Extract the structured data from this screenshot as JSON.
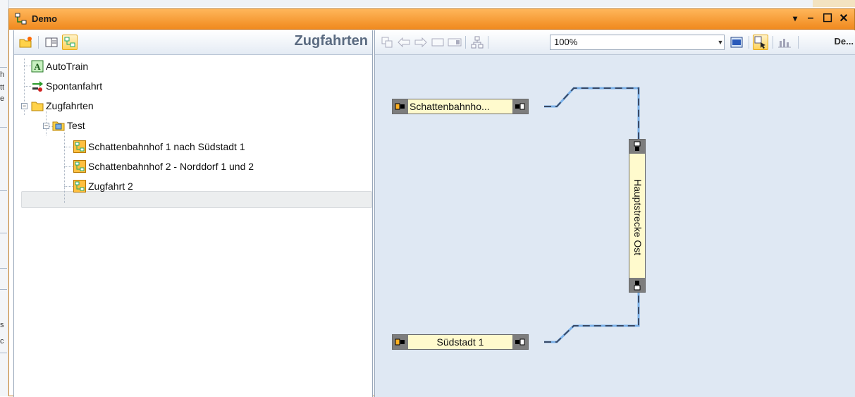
{
  "window": {
    "title": "Demo",
    "controls": [
      "▾",
      "–",
      "☐",
      "✕"
    ]
  },
  "background_fragments": [
    "h",
    "tt",
    "e",
    "s",
    "c"
  ],
  "left_panel": {
    "title": "Zugfahrten",
    "toolbar_icons": [
      "new-folder-icon",
      "list-view-icon",
      "tree-view-icon"
    ]
  },
  "tree": {
    "items": [
      {
        "label": "AutoTrain",
        "icon": "autotrain-icon"
      },
      {
        "label": "Spontanfahrt",
        "icon": "spontaneous-run-icon"
      },
      {
        "label": "Zugfahrten",
        "icon": "folder-icon"
      },
      {
        "label": "Test",
        "icon": "test-folder-icon"
      },
      {
        "label": "Schattenbahnhof 1 nach Südstadt 1",
        "icon": "train-route-icon"
      },
      {
        "label": "Schattenbahnhof 2 - Norddorf 1 und 2",
        "icon": "train-route-icon"
      },
      {
        "label": "Zugfahrt 2",
        "icon": "train-route-icon",
        "selected": true
      }
    ]
  },
  "right_panel": {
    "toolbar_icons": [
      "copy-icon",
      "arrow-left-icon",
      "arrow-right-icon",
      "block-icon",
      "wide-block-icon",
      "layout-icon",
      "view-icon",
      "select-icon",
      "chart-icon"
    ],
    "zoom": "100%",
    "de_button": "De..."
  },
  "diagram": {
    "blocks": [
      {
        "label": "Schattenbahnho..."
      },
      {
        "label": "Hauptstrecke Ost"
      },
      {
        "label": "Südstadt 1"
      }
    ]
  },
  "colors": {
    "title_orange": "#f5a040",
    "canvas_bg": "#dfe8f3",
    "block_fill": "#fffacd",
    "connector": "#3a5a90"
  }
}
